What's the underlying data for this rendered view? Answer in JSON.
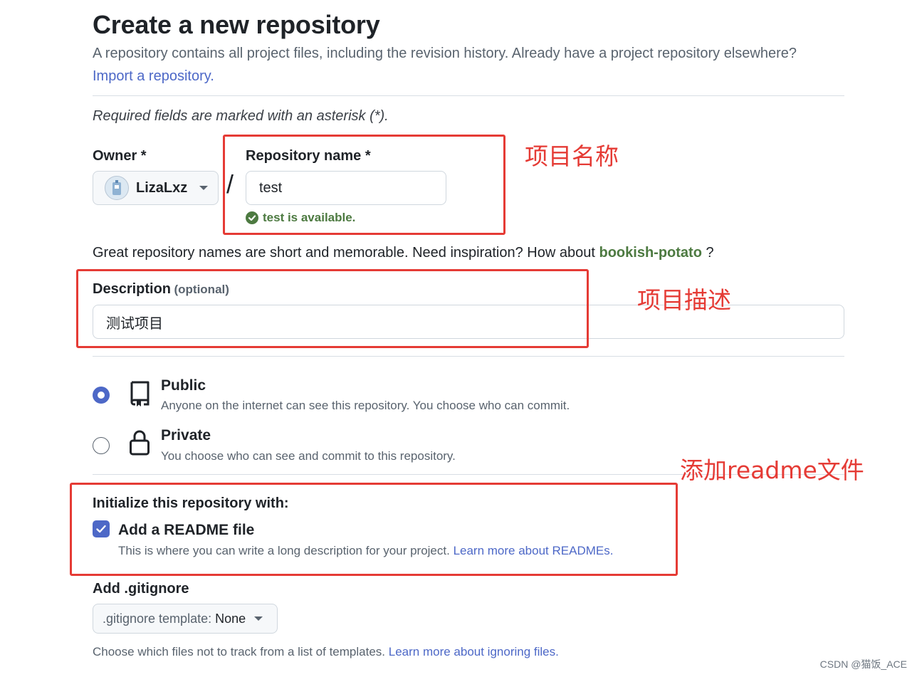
{
  "header": {
    "title": "Create a new repository",
    "subtitle": "A repository contains all project files, including the revision history. Already have a project repository elsewhere?",
    "import_link": "Import a repository."
  },
  "required_note": "Required fields are marked with an asterisk (*).",
  "owner": {
    "label": "Owner *",
    "value": "LizaLxz"
  },
  "separator": "/",
  "repo_name": {
    "label": "Repository name *",
    "value": "test",
    "availability": "test is available."
  },
  "suggestion": {
    "text": "Great repository names are short and memorable. Need inspiration? How about",
    "name": "bookish-potato",
    "suffix": "?"
  },
  "description": {
    "label": "Description",
    "optional": "(optional)",
    "value": "测试项目"
  },
  "visibility": {
    "public": {
      "title": "Public",
      "desc": "Anyone on the internet can see this repository. You choose who can commit.",
      "selected": true
    },
    "private": {
      "title": "Private",
      "desc": "You choose who can see and commit to this repository.",
      "selected": false
    }
  },
  "initialize": {
    "heading": "Initialize this repository with:",
    "readme": {
      "label": "Add a README file",
      "checked": true,
      "desc": "This is where you can write a long description for your project.",
      "link": "Learn more about READMEs."
    }
  },
  "gitignore": {
    "label": "Add .gitignore",
    "select_prefix": ".gitignore template:",
    "select_value": "None",
    "desc": "Choose which files not to track from a list of templates.",
    "link": "Learn more about ignoring files."
  },
  "annotations": {
    "repo_name": "项目名称",
    "description": "项目描述",
    "readme": "添加readme文件"
  },
  "watermark": "CSDN @猫饭_ACE",
  "colors": {
    "accent": "#4d68c7",
    "success": "#4d7a41",
    "annotation": "#e53b35"
  }
}
